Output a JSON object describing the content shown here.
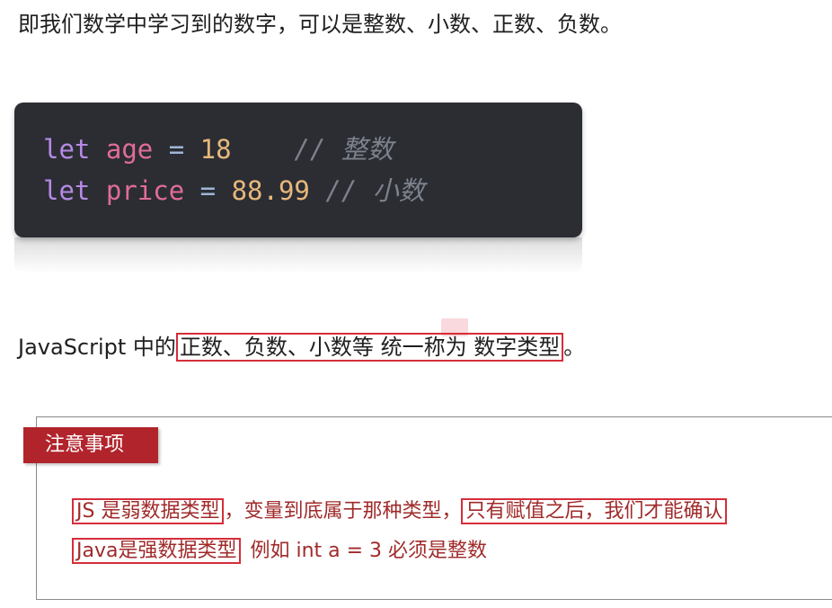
{
  "intro": {
    "text": "即我们数学中学习到的数字，可以是整数、小数、正数、负数。"
  },
  "code": {
    "line1": {
      "keyword": "let",
      "name": "age",
      "op": "=",
      "value": "18",
      "comment": "// 整数"
    },
    "line2": {
      "keyword": "let",
      "name": "price",
      "op": "=",
      "value": "88.99",
      "comment": "// 小数"
    }
  },
  "para2": {
    "prefix": "JavaScript 中的",
    "highlight": "正数、负数、小数等 统一称为 数字类型",
    "suffix": "。"
  },
  "note": {
    "tag": "注意事项",
    "line1": {
      "box1": "JS 是弱数据类型",
      "middle": "，变量到底属于那种类型，",
      "box2": "只有赋值之后，我们才能确认"
    },
    "line2": {
      "box1": "Java是强数据类型",
      "rest": "例如  int  a = 3    必须是整数"
    }
  },
  "colors": {
    "code_bg": "#2b2d33",
    "highlight_border": "#d62d3a",
    "note_tag_bg": "#b2242c",
    "note_text": "#a02a2a"
  }
}
